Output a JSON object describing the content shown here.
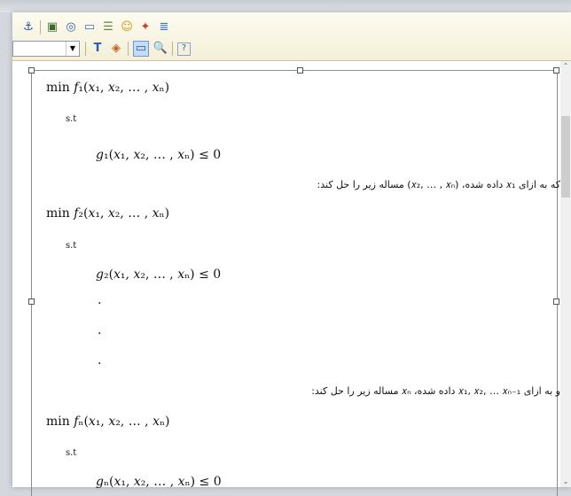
{
  "toolbar": {
    "row1_icons": [
      "anchor-icon",
      "image-icon",
      "compass-icon",
      "window-icon",
      "lines-icon",
      "smiley-icon",
      "objects-icon",
      "list-icon"
    ],
    "row1_glyphs": [
      "⚓",
      "▣",
      "◎",
      "▭",
      "☰",
      "☺",
      "✦",
      "≣"
    ],
    "row2_glyphs": [
      "T",
      "◈",
      "▭",
      "🔍",
      "?"
    ],
    "combo_value": ""
  },
  "document": {
    "block1": {
      "objective": "min 𝑓₁(𝑥₁, 𝑥₂, … , 𝑥ₙ)",
      "st": "s.t",
      "constraint": "𝑔₁(𝑥₁, 𝑥₂, … , 𝑥ₙ) ≤ 0"
    },
    "line1": "که به ازای 𝑥₁ داده شده، (𝑥₂, … , 𝑥ₙ) مساله زیر را حل کند:",
    "block2": {
      "objective": "min 𝑓₂(𝑥₁, 𝑥₂, … , 𝑥ₙ)",
      "st": "s.t",
      "constraint": "𝑔₂(𝑥₁, 𝑥₂, … , 𝑥ₙ) ≤ 0",
      "dots": [
        ".",
        ".",
        "."
      ]
    },
    "line2": "و به ازای 𝑥₁, 𝑥₂, … 𝑥ₙ₋₁ داده شده، 𝑥ₙ مساله زیر را حل کند:",
    "block3": {
      "objective": "min 𝑓ₙ(𝑥₁, 𝑥₂, … , 𝑥ₙ)",
      "st": "s.t",
      "constraint": "𝑔ₙ(𝑥₁, 𝑥₂, … , 𝑥ₙ) ≤ 0"
    }
  },
  "scrollbar": {
    "up": "⌃",
    "down": "⌄"
  }
}
